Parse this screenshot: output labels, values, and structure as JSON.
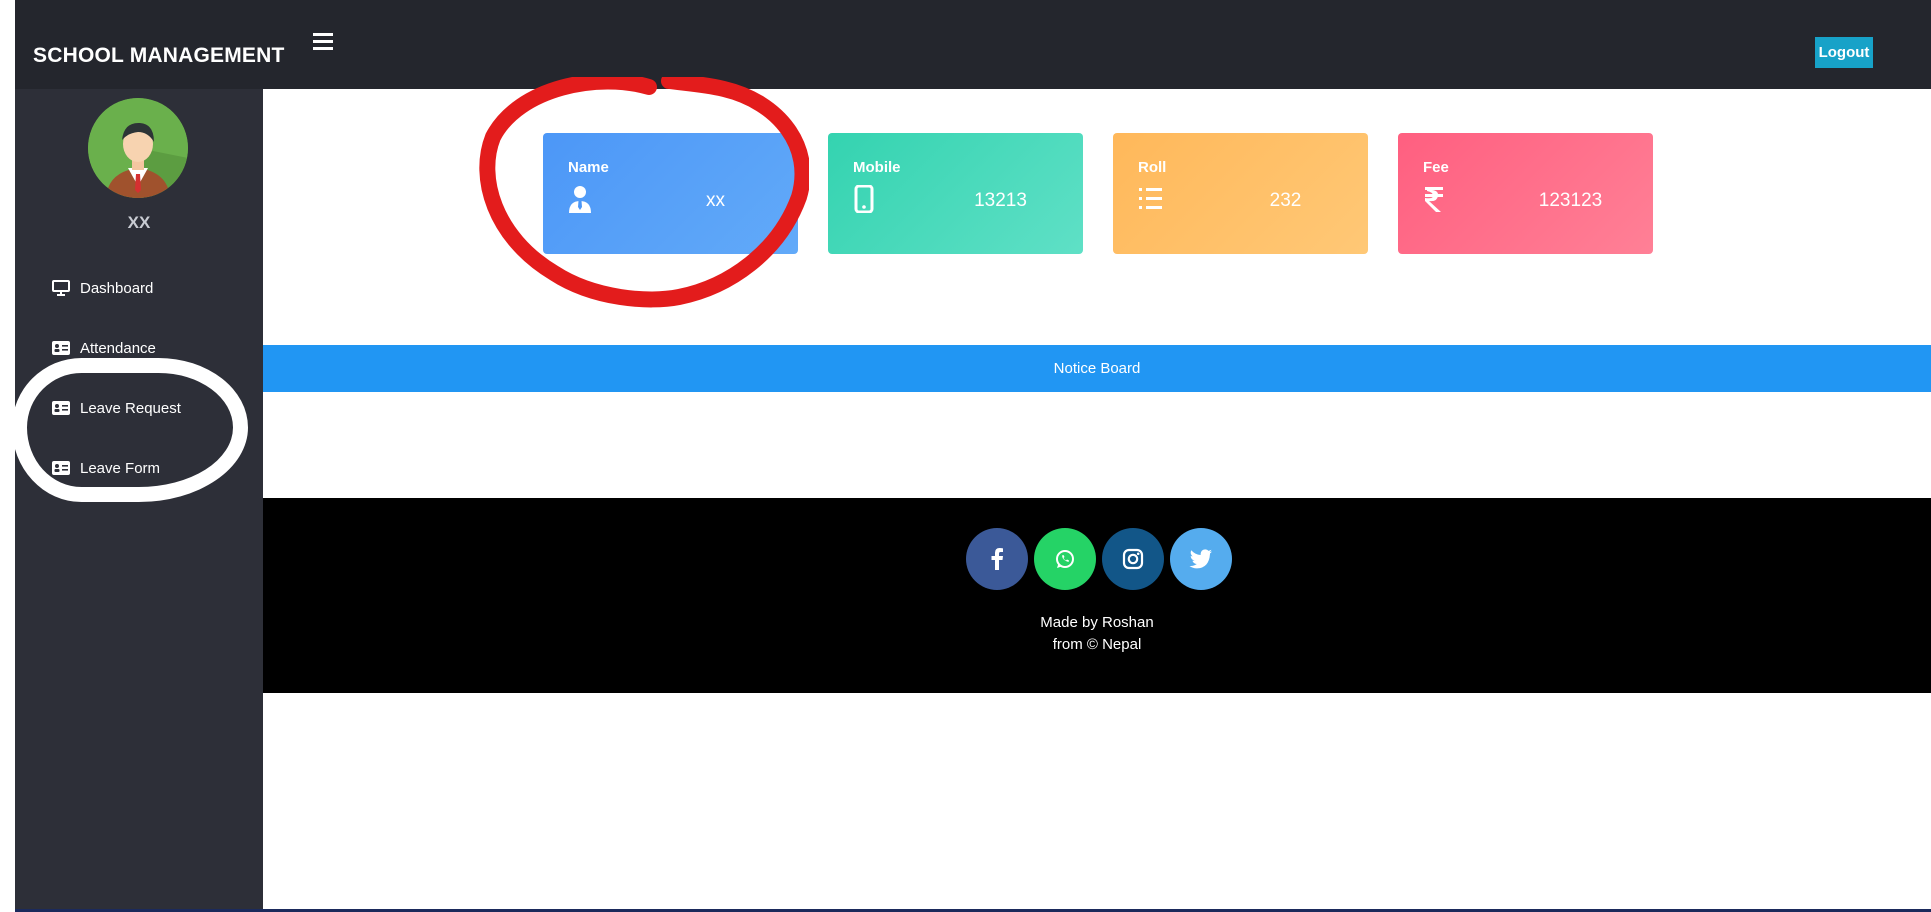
{
  "header": {
    "brand": "SCHOOL MANAGEMENT",
    "menu_icon": "hamburger-icon",
    "logout_label": "Logout"
  },
  "sidebar": {
    "username": "XX",
    "items": [
      {
        "label": "Dashboard",
        "icon": "monitor-icon"
      },
      {
        "label": "Attendance",
        "icon": "id-card-icon"
      },
      {
        "label": "Leave Request",
        "icon": "id-card-icon"
      },
      {
        "label": "Leave Form",
        "icon": "id-card-icon"
      }
    ]
  },
  "cards": [
    {
      "label": "Name",
      "value": "xx",
      "icon": "user-tie-icon",
      "color": "#4c97f7"
    },
    {
      "label": "Mobile",
      "value": "13213",
      "icon": "mobile-icon",
      "color": "#34d3b0"
    },
    {
      "label": "Roll",
      "value": "232",
      "icon": "list-ol-icon",
      "color": "#ffb85a"
    },
    {
      "label": "Fee",
      "value": "123123",
      "icon": "rupee-icon",
      "color": "#ff5f80"
    }
  ],
  "notice": {
    "label": "Notice Board"
  },
  "footer": {
    "social": [
      "facebook-icon",
      "whatsapp-icon",
      "instagram-icon",
      "twitter-icon"
    ],
    "credit_line1": "Made by Roshan",
    "credit_line2": "from © Nepal"
  },
  "colors": {
    "topbar": "#24262d",
    "sidebar": "#2d2f38",
    "notice": "#2196f3",
    "logout": "#17a2c8",
    "annotation_red": "#e31c1c"
  }
}
